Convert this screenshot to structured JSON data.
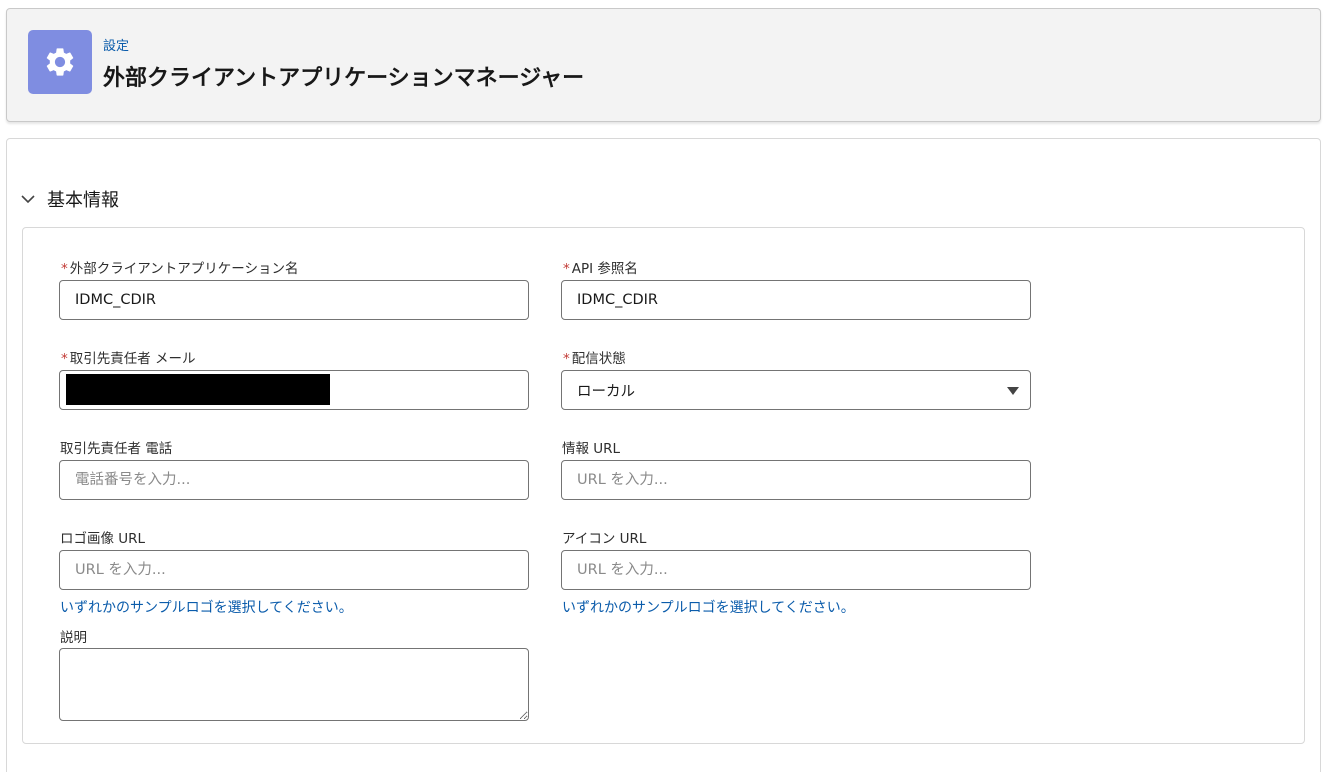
{
  "header": {
    "breadcrumb": "設定",
    "title": "外部クライアントアプリケーションマネージャー",
    "icon": "gear-icon",
    "icon_bg": "#7f8de1"
  },
  "section": {
    "title": "基本情報",
    "expanded": true
  },
  "form": {
    "app_name": {
      "label": "外部クライアントアプリケーション名",
      "required": "*",
      "value": "IDMC_CDIR"
    },
    "api_name": {
      "label": "API 参照名",
      "required": "*",
      "value": "IDMC_CDIR"
    },
    "contact_email": {
      "label": "取引先責任者 メール",
      "required": "*"
    },
    "distribution": {
      "label": "配信状態",
      "required": "*",
      "value": "ローカル"
    },
    "contact_phone": {
      "label": "取引先責任者 電話",
      "placeholder": "電話番号を入力..."
    },
    "info_url": {
      "label": "情報 URL",
      "placeholder": "URL を入力..."
    },
    "logo_url": {
      "label": "ロゴ画像 URL",
      "placeholder": "URL を入力...",
      "link": "いずれかのサンプルロゴを選択してください。"
    },
    "icon_url": {
      "label": "アイコン URL",
      "placeholder": "URL を入力...",
      "link": "いずれかのサンプルロゴを選択してください。"
    },
    "description": {
      "label": "説明"
    }
  },
  "colors": {
    "link": "#0b5cab",
    "required": "#c23934",
    "border": "#747474"
  }
}
